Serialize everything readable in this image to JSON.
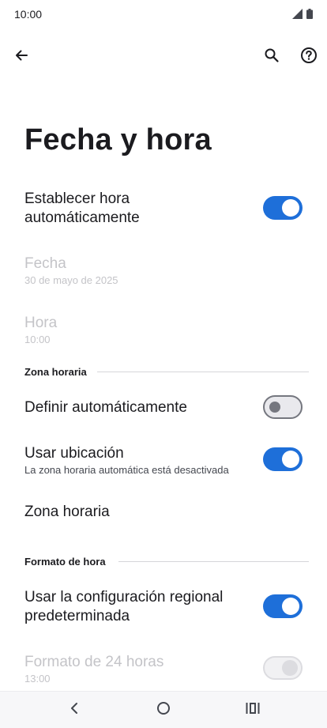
{
  "status_bar": {
    "time": "10:00",
    "icons": [
      "signal-icon",
      "battery-icon"
    ]
  },
  "top_bar": {
    "icons": [
      "back-arrow-icon",
      "search-icon",
      "help-icon"
    ]
  },
  "page": {
    "title": "Fecha y hora"
  },
  "settings": {
    "auto_time": {
      "title": "Establecer hora automáticamente",
      "enabled": true
    },
    "date": {
      "title": "Fecha",
      "value": "30 de mayo de 2025",
      "disabled": true
    },
    "time": {
      "title": "Hora",
      "value": "10:00",
      "disabled": true
    }
  },
  "section_timezone": {
    "header": "Zona horaria",
    "define_auto": {
      "title": "Definir automáticamente",
      "enabled": false
    },
    "use_location": {
      "title": "Usar ubicación",
      "subtitle": "La zona horaria automática está desactivada",
      "enabled": true
    },
    "timezone": {
      "title": "Zona horaria"
    }
  },
  "section_format": {
    "header": "Formato de hora",
    "regional_default": {
      "title": "Usar la configuración regional predeterminada",
      "enabled": true
    },
    "format_24": {
      "title": "Formato de 24 horas",
      "value": "13:00",
      "disabled": true
    }
  },
  "nav_bar": {
    "icons": [
      "nav-back-icon",
      "nav-home-icon",
      "nav-recents-icon"
    ]
  },
  "colors": {
    "accent": "#1e6fd9",
    "text": "#1b1b1f",
    "disabled_text": "#c4c4c8"
  }
}
